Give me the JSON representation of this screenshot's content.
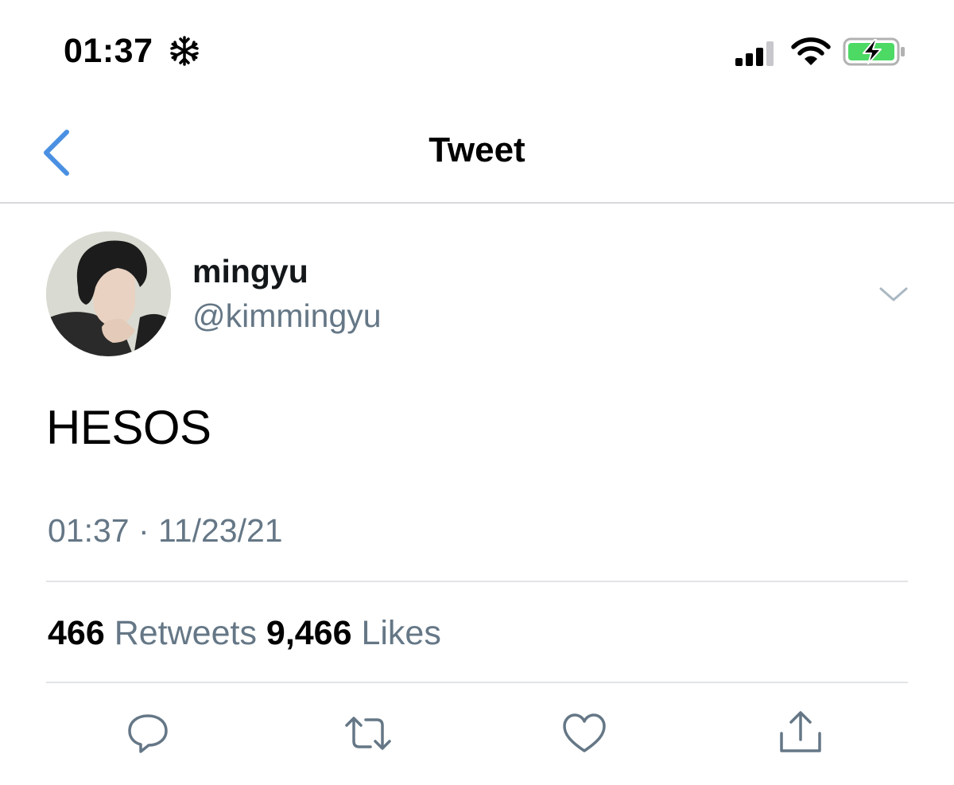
{
  "status_bar": {
    "time": "01:37",
    "time_icon": "snowflake-icon",
    "signal_icon": "cellular-signal-icon",
    "wifi_icon": "wifi-icon",
    "battery_icon": "battery-charging-icon",
    "battery_color": "#4cd964"
  },
  "nav": {
    "title": "Tweet",
    "back_icon": "chevron-left-icon"
  },
  "tweet": {
    "author": {
      "name": "mingyu",
      "handle": "@kimmingyu",
      "avatar": "avatar-photo"
    },
    "text": "HESOS",
    "timestamp": "01:37 · 11/23/21",
    "stats": {
      "retweets_count": "466",
      "retweets_label": "Retweets",
      "likes_count": "9,466",
      "likes_label": "Likes"
    },
    "actions": [
      "reply-icon",
      "retweet-icon",
      "like-icon",
      "share-icon"
    ]
  },
  "colors": {
    "accent": "#4a90e2",
    "secondary_text": "#657786",
    "divider": "#e1e4e7"
  }
}
